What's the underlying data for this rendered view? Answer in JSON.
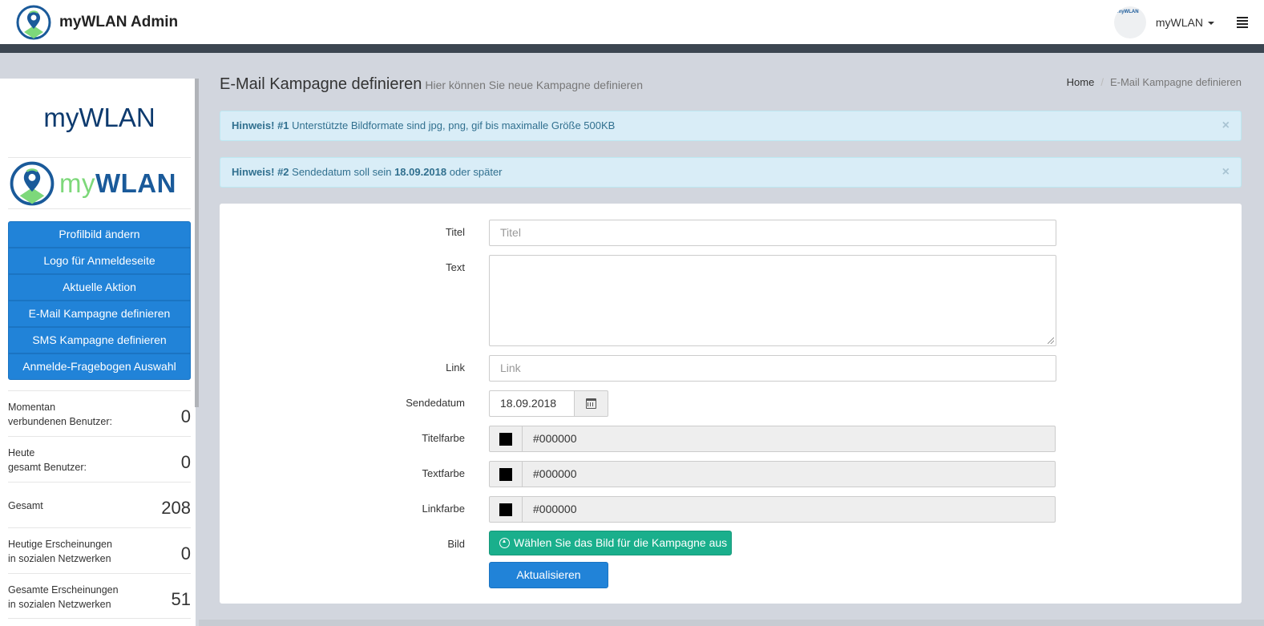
{
  "header": {
    "title": "myWLAN Admin",
    "avatar_mini_text": "myWLAN",
    "user_name": "myWLAN",
    "logo_icon": "map-pin-wifi-icon",
    "menu_icon": "hamburger-icon"
  },
  "sidebar": {
    "title": "myWLAN",
    "logo": {
      "my": "my",
      "wlan": "WLAN"
    },
    "menu": [
      {
        "label": "Profilbild ändern"
      },
      {
        "label": "Logo für Anmeldeseite"
      },
      {
        "label": "Aktuelle Aktion"
      },
      {
        "label": "E-Mail Kampagne definieren"
      },
      {
        "label": "SMS Kampagne definieren"
      },
      {
        "label": "Anmelde-Fragebogen Auswahl"
      }
    ],
    "stats": [
      {
        "line1": "Momentan",
        "line2": "verbundenen Benutzer:",
        "value": "0"
      },
      {
        "line1": "Heute",
        "line2": "gesamt Benutzer:",
        "value": "0"
      },
      {
        "line1": "Gesamt",
        "line2": "",
        "value": "208"
      },
      {
        "line1": "Heutige Erscheinungen",
        "line2": "in sozialen Netzwerken",
        "value": "0"
      },
      {
        "line1": "Gesamte Erscheinungen",
        "line2": "in sozialen Netzwerken",
        "value": "51"
      }
    ]
  },
  "page": {
    "title": "E-Mail Kampagne definieren",
    "subtitle": "Hier können Sie neue Kampagne definieren",
    "breadcrumb": {
      "home": "Home",
      "sep": "/",
      "current": "E-Mail Kampagne definieren"
    }
  },
  "alerts": [
    {
      "strong": "Hinweis! #1",
      "text": " Unterstützte Bildformate sind jpg, png, gif bis maximalle Größe 500KB",
      "close": "×"
    },
    {
      "strong": "Hinweis! #2",
      "text_before": " Sendedatum soll sein ",
      "date": "18.09.2018",
      "text_after": " oder später",
      "close": "×"
    }
  ],
  "form": {
    "titel": {
      "label": "Titel",
      "placeholder": "Titel"
    },
    "text": {
      "label": "Text"
    },
    "link": {
      "label": "Link",
      "placeholder": "Link"
    },
    "sendedatum": {
      "label": "Sendedatum",
      "value": "18.09.2018",
      "icon": "calendar-icon"
    },
    "titelfarbe": {
      "label": "Titelfarbe",
      "value": "#000000",
      "swatch_color": "#000000"
    },
    "textfarbe": {
      "label": "Textfarbe",
      "value": "#000000",
      "swatch_color": "#000000"
    },
    "linkfarbe": {
      "label": "Linkfarbe",
      "value": "#000000",
      "swatch_color": "#000000"
    },
    "bild": {
      "label": "Bild",
      "button": "Wählen Sie das Bild für die Kampagne aus",
      "icon": "upload-circle-icon"
    },
    "submit": "Aktualisieren"
  },
  "colors": {
    "primary": "#2183d8",
    "success": "#1aaf8c",
    "alert_bg": "#d9edf7",
    "alert_text": "#31708f"
  }
}
